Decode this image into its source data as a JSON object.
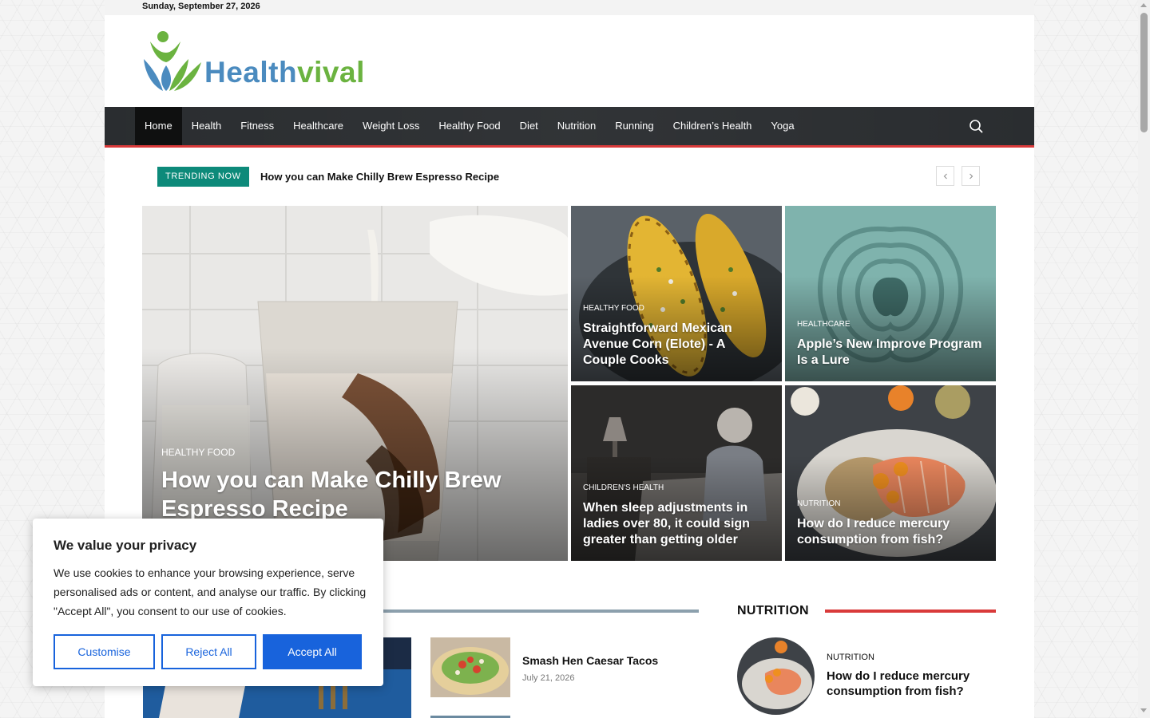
{
  "topbar": {
    "date": "Sunday, September 27, 2026"
  },
  "logo": {
    "part1": "Health",
    "part2": "vival"
  },
  "nav": {
    "items": [
      "Home",
      "Health",
      "Fitness",
      "Healthcare",
      "Weight Loss",
      "Healthy Food",
      "Diet",
      "Nutrition",
      "Running",
      "Children’s Health",
      "Yoga"
    ],
    "active": "Home"
  },
  "trending": {
    "badge": "TRENDING NOW",
    "title": "How you can Make Chilly Brew Espresso Recipe"
  },
  "featured": {
    "main": {
      "category": "HEALTHY FOOD",
      "title": "How you can Make Chilly Brew Espresso Recipe"
    },
    "tiles": [
      {
        "category": "HEALTHY FOOD",
        "title": "Straightforward Mexican Avenue Corn (Elote) - A Couple Cooks"
      },
      {
        "category": "HEALTHCARE",
        "title": "Apple’s New Improve Program Is a Lure"
      },
      {
        "category": "CHILDREN'S HEALTH",
        "title": "When sleep adjustments in ladies over 80, it could sign greater than getting older"
      },
      {
        "category": "NUTRITION",
        "title": "How do I reduce mercury consumption from fish?"
      }
    ]
  },
  "list": {
    "items": [
      {
        "title": "Smash Hen Caesar Tacos",
        "date": "July 21, 2026"
      }
    ]
  },
  "nutrition": {
    "heading": "NUTRITION",
    "item": {
      "category": "NUTRITION",
      "title": "How do I reduce mercury consumption from fish?"
    }
  },
  "cookie": {
    "title": "We value your privacy",
    "text": "We use cookies to enhance your browsing experience, serve personalised ads or content, and analyse our traffic. By clicking \"Accept All\", you consent to our use of cookies.",
    "customise": "Customise",
    "reject": "Reject All",
    "accept": "Accept All"
  },
  "colors": {
    "accent_red": "#d93a3a",
    "trending_teal": "#0d8a7a",
    "cookie_blue": "#1863dc",
    "nav_bg": "#26292c"
  }
}
